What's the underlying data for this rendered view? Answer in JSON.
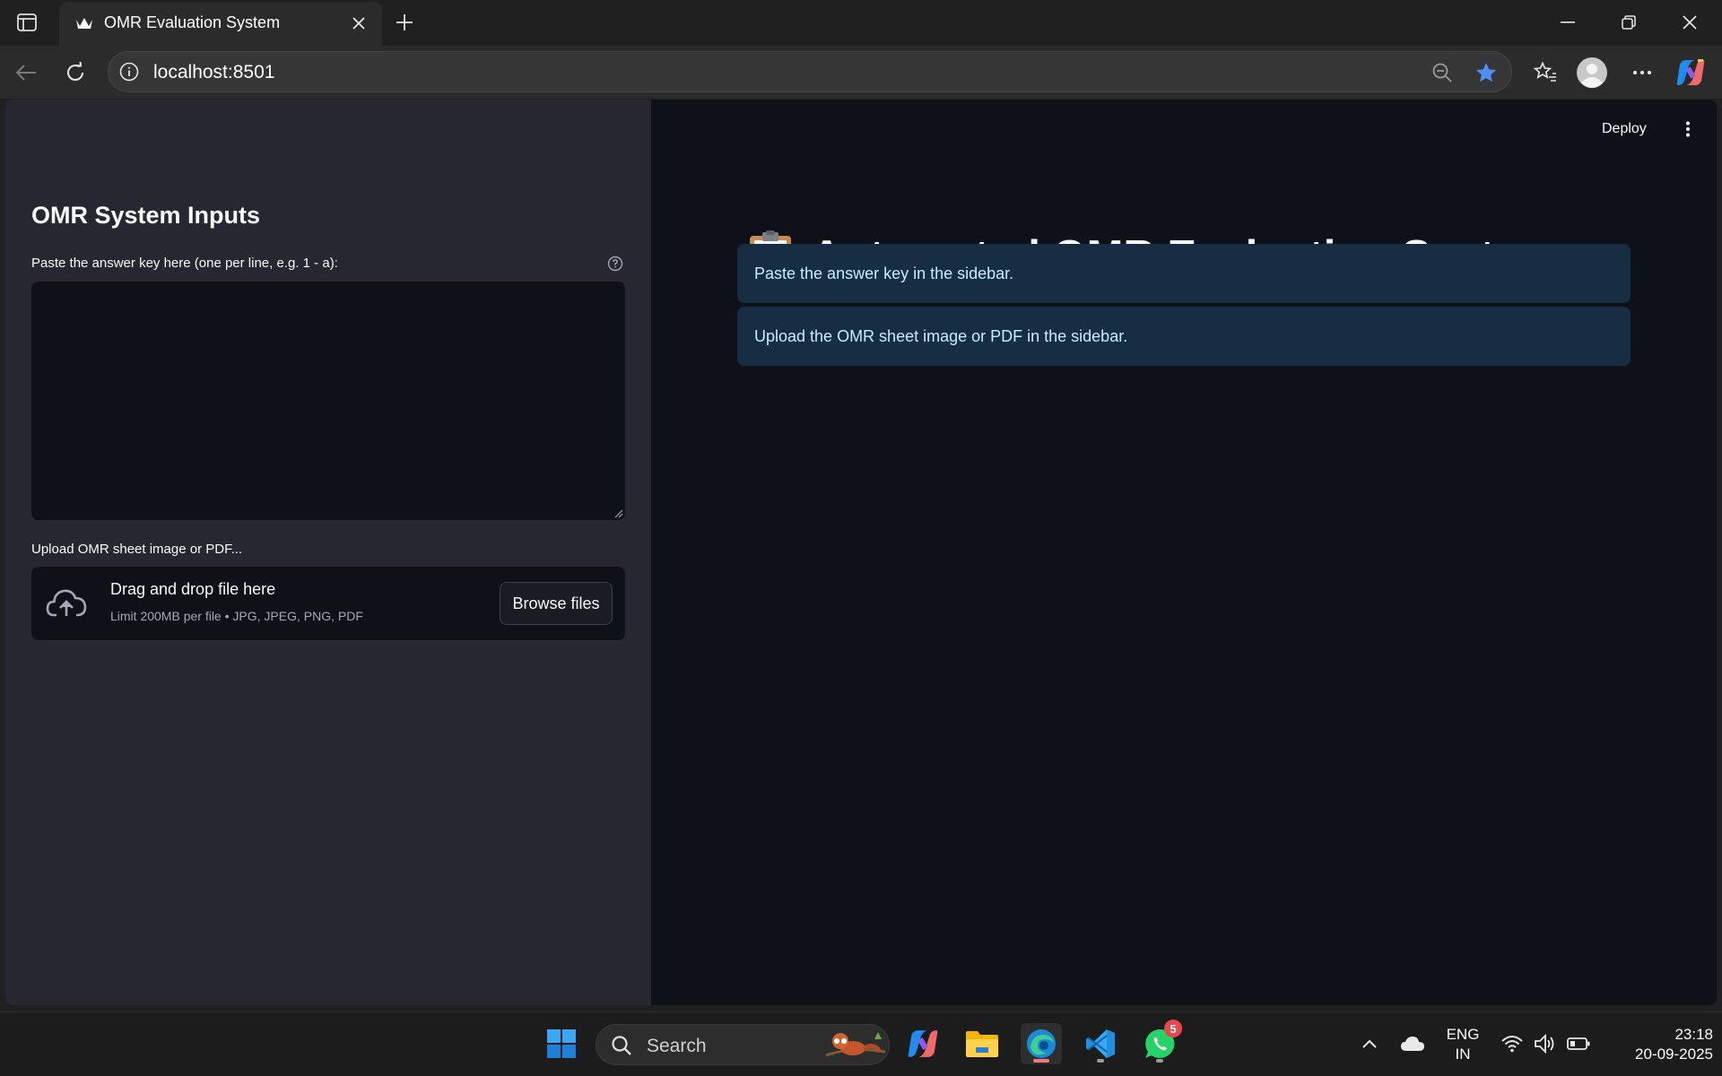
{
  "browser": {
    "tab_title": "OMR Evaluation System",
    "url": "localhost:8501"
  },
  "sidebar": {
    "title": "OMR System Inputs",
    "answer_key_label": "Paste the answer key here (one per line, e.g. 1 - a):",
    "answer_key_value": "",
    "upload_label": "Upload OMR sheet image or PDF...",
    "upload_main": "Drag and drop file here",
    "upload_sub": "Limit 200MB per file • JPG, JPEG, PNG, PDF",
    "browse_label": "Browse files"
  },
  "main": {
    "deploy_label": "Deploy",
    "title": "Automated OMR Evaluation System",
    "title_icon": "clipboard-icon",
    "alerts": [
      "Paste the answer key in the sidebar.",
      "Upload the OMR sheet image or PDF in the sidebar."
    ]
  },
  "taskbar": {
    "search_label": "Search",
    "whatsapp_badge": "5",
    "lang_line1": "ENG",
    "lang_line2": "IN",
    "time": "23:18",
    "date": "20-09-2025"
  },
  "colors": {
    "sidebar_bg": "#262730",
    "main_bg": "#0e1117",
    "alert_bg": "#172d43",
    "alert_text": "#c7ebff",
    "accent_star": "#4f8ff7"
  }
}
